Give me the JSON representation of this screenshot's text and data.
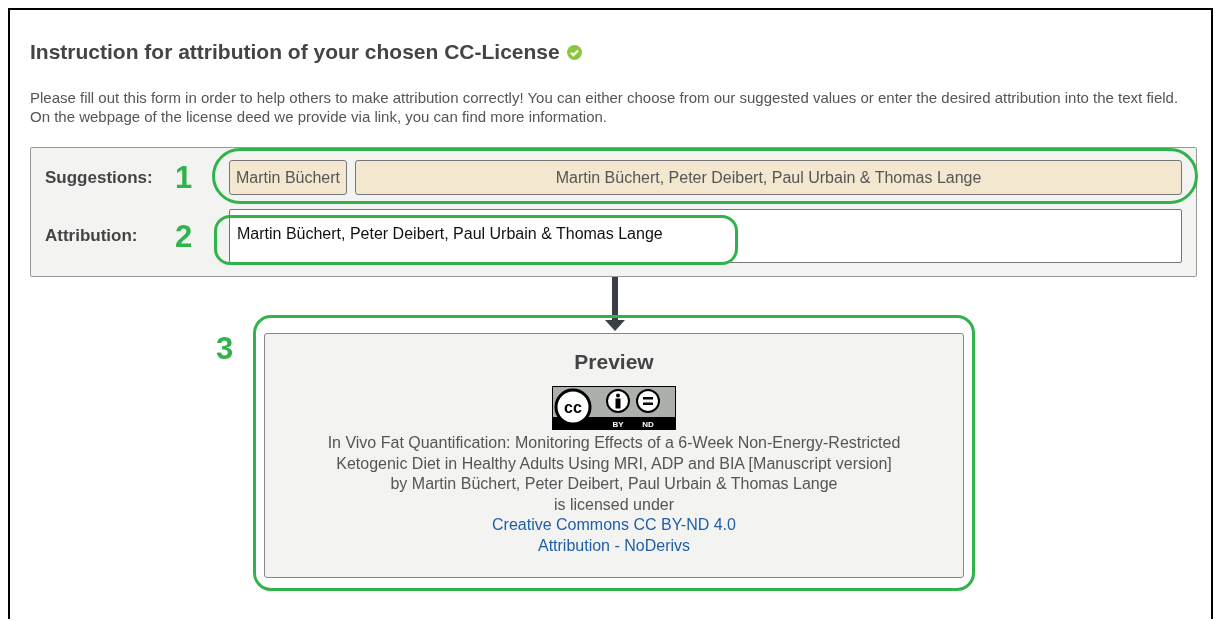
{
  "heading": {
    "title": "Instruction for attribution of your chosen CC-License",
    "verified": true
  },
  "intro": "Please fill out this form in order to help others to make attribution correctly! You can either choose from our suggested values or enter the desired attribution into the text field. On the webpage of the license deed we provide via link, you can find more information.",
  "form": {
    "suggestions": {
      "label": "Suggestions:",
      "marker": "1",
      "items": [
        "Martin Büchert",
        "Martin Büchert, Peter Deibert, Paul Urbain & Thomas Lange"
      ]
    },
    "attribution": {
      "label": "Attribution:",
      "marker": "2",
      "value": "Martin Büchert, Peter Deibert, Paul Urbain & Thomas Lange"
    }
  },
  "preview": {
    "marker": "3",
    "title": "Preview",
    "badge_labels": [
      "cc",
      "BY",
      "ND"
    ],
    "lines": [
      "In Vivo Fat Quantification: Monitoring Effects of a 6-Week Non-Energy-Restricted",
      "Ketogenic Diet in Healthy Adults Using MRI, ADP and BIA [Manuscript version]",
      "by Martin Büchert, Peter Deibert, Paul Urbain & Thomas Lange",
      "is licensed under"
    ],
    "links": [
      "Creative Commons CC BY-ND 4.0",
      "Attribution - NoDerivs"
    ]
  }
}
